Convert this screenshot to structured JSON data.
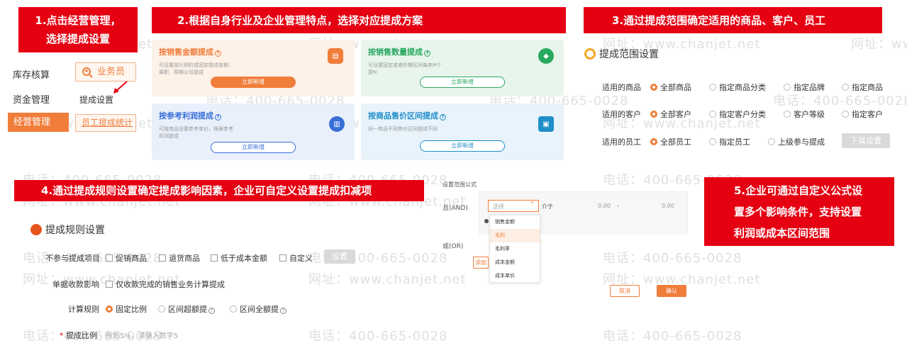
{
  "steps": {
    "s1_line1": "1.点击经营管理，",
    "s1_line2": "选择提成设置",
    "s2": "2.根据自身行业及企业管理特点，选择对应提成方案",
    "s3": "3.通过提成范围确定适用的商品、客户、员工",
    "s4": "4.通过提成规则设置确定提成影响因素，企业可自定义设置提成扣减项",
    "s5_line1": "5.企业可通过自定义公式设",
    "s5_line2": "置多个影响条件，支持设置",
    "s5_line3": "利润或成本区间范围"
  },
  "watermark": {
    "phone": "电话：400-665-0028",
    "site": "网址：www.chanjet.net"
  },
  "nav": {
    "inventory": "库存核算",
    "funds": "资金管理",
    "operation": "经营管理",
    "salesman": "业务员",
    "commission_settings": "提成设置",
    "employee_stats": "员工提成统计"
  },
  "plans": [
    {
      "title": "按销售金额提成",
      "desc": "可设置按比例的或固定提成金额：离职、预期公司提成",
      "button": "立即新增",
      "color": "#f07d3a",
      "bg": "#fdf1e8"
    },
    {
      "title": "按销售数量提成",
      "desc": "可设置固定或者阶梯区间每卖M个提N",
      "button": "立即新增",
      "color": "#27a95e",
      "bg": "#e8f5ec"
    },
    {
      "title": "按参考利润提成",
      "desc": "可按商品设置参考单价，根据参考利润提成",
      "button": "立即新增",
      "color": "#3a6fd8",
      "bg": "#e9f0fb"
    },
    {
      "title": "按商品售价区间提成",
      "desc": "同一商品不同售价区间提成不同",
      "button": "立即新增",
      "color": "#1f8fc9",
      "bg": "#e8f3fb"
    }
  ],
  "scope": {
    "title": "提成范围设置",
    "goods_label": "适用的商品",
    "goods_opts": [
      "全部商品",
      "指定商品分类",
      "指定品牌",
      "指定商品"
    ],
    "customer_label": "适用的客户",
    "customer_opts": [
      "全部客户",
      "指定客户分类",
      "客户等级",
      "指定客户"
    ],
    "employee_label": "适用的员工",
    "employee_opts": [
      "全部员工",
      "指定员工",
      "上级参与提成"
    ],
    "sub_button": "下属设置"
  },
  "rules": {
    "title": "提成规则设置",
    "exclude_label": "不参与提成项目",
    "exclude_opts": [
      "促销商品",
      "退货商品",
      "低于成本金额",
      "自定义"
    ],
    "settings_btn": "设置",
    "payment_label": "单据收款影响",
    "payment_opt": "仅收款完成的销售业务计算提成",
    "calc_label": "计算规则",
    "calc_opts": [
      "固定比例",
      "区间超额提",
      "区间全额提"
    ],
    "ratio_label": "提成比例",
    "ratio_placeholder": "例如5%，请输入数字5",
    "required_mark": "*"
  },
  "formula": {
    "title": "设置范围公式",
    "and_label": "且(AND)",
    "select_placeholder": "选择",
    "between": "介于",
    "from_val": "0.00",
    "dash": "-",
    "to_val": "0.00",
    "or_label": "或(OR)",
    "add_btn": "添加",
    "dropdown": [
      "销售金额",
      "毛利",
      "毛利率",
      "成本金额",
      "成本单价"
    ],
    "cancel": "取消",
    "confirm": "确认"
  }
}
